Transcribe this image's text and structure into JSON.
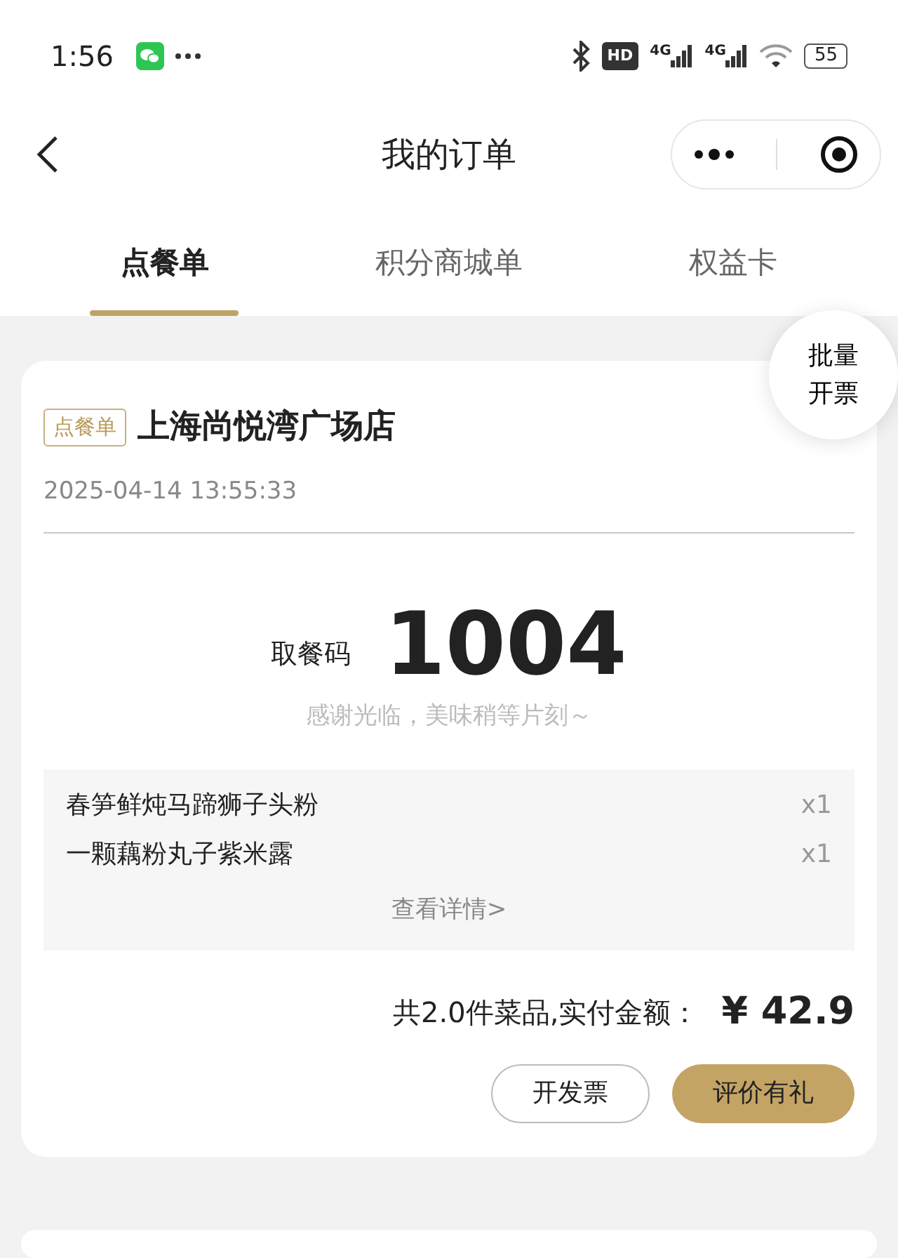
{
  "status_bar": {
    "time": "1:56",
    "hd": "HD",
    "network": [
      "4G",
      "4G"
    ],
    "battery": "55"
  },
  "nav": {
    "title": "我的订单"
  },
  "tabs": [
    {
      "label": "点餐单",
      "selected": true
    },
    {
      "label": "积分商城单",
      "selected": false
    },
    {
      "label": "权益卡",
      "selected": false
    }
  ],
  "float_button": {
    "lines": [
      "批量",
      "开票"
    ]
  },
  "order": {
    "tag": "点餐单",
    "store": "上海尚悦湾广场店",
    "datetime": "2025-04-14 13:55:33",
    "pickup_label": "取餐码",
    "pickup_code": "1004",
    "message": "感谢光临，美味稍等片刻～",
    "items": [
      {
        "name": "春笋鲜炖马蹄狮子头粉",
        "qty": "x1"
      },
      {
        "name": "一颗藕粉丸子紫米露",
        "qty": "x1"
      }
    ],
    "details_link": "查看详情>",
    "summary": "共2.0件菜品,实付金额：",
    "total": "¥ 42.9",
    "buttons": [
      {
        "label": "开发票",
        "kind": "outline"
      },
      {
        "label": "评价有礼",
        "kind": "filled"
      }
    ]
  }
}
